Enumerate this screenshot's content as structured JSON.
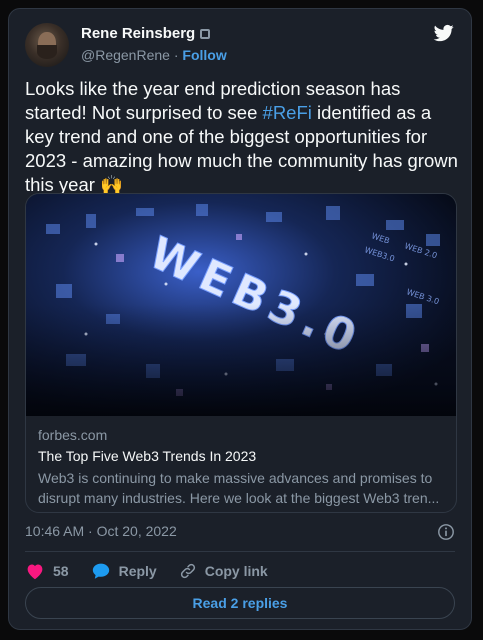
{
  "author": {
    "name": "Rene Reinsberg",
    "handle": "@RegenRene",
    "separator": "·",
    "follow_label": "Follow"
  },
  "tweet": {
    "text_before": "Looks like the year end prediction season has started! Not surprised to see ",
    "hashtag": "#ReFi",
    "text_after": " identified as a key trend and one of the biggest opportunities for 2023 - amazing how much the community has grown this year 🙌"
  },
  "link_card": {
    "domain": "forbes.com",
    "title": "The Top Five Web3 Trends In 2023",
    "description": "Web3 is continuing to make massive advances and promises to disrupt many industries. Here we look at the biggest Web3 tren...",
    "image_text": "WEB3.0"
  },
  "timestamp": "10:46 AM · Oct 20, 2022",
  "actions": {
    "like_count": "58",
    "reply_label": "Reply",
    "copy_link_label": "Copy link"
  },
  "read_replies_label": "Read 2 replies",
  "colors": {
    "background": "#1b2029",
    "accent": "#4a9fe6",
    "like": "#f91880",
    "muted": "#8b98a5"
  },
  "icons": [
    "verified-badge-icon",
    "twitter-bird-icon",
    "info-icon",
    "heart-icon",
    "reply-bubble-icon",
    "link-icon"
  ]
}
